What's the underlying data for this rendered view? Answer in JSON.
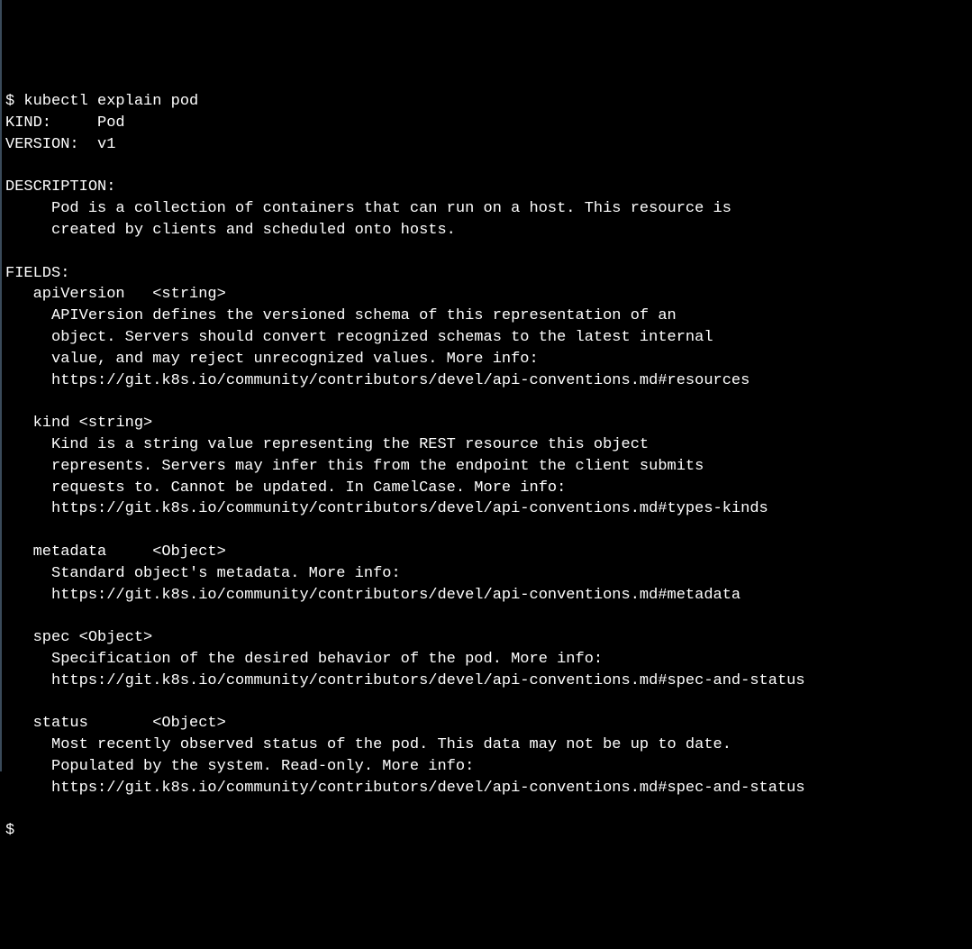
{
  "prompt": "$ ",
  "command": "kubectl explain pod",
  "kind_line": "KIND:     Pod",
  "version_line": "VERSION:  v1",
  "desc_header": "DESCRIPTION:",
  "desc_l1": "     Pod is a collection of containers that can run on a host. This resource is",
  "desc_l2": "     created by clients and scheduled onto hosts.",
  "fields_header": "FIELDS:",
  "f1_name": "   apiVersion   <string>",
  "f1_l1": "     APIVersion defines the versioned schema of this representation of an",
  "f1_l2": "     object. Servers should convert recognized schemas to the latest internal",
  "f1_l3": "     value, and may reject unrecognized values. More info:",
  "f1_l4": "     https://git.k8s.io/community/contributors/devel/api-conventions.md#resources",
  "f2_name": "   kind <string>",
  "f2_l1": "     Kind is a string value representing the REST resource this object",
  "f2_l2": "     represents. Servers may infer this from the endpoint the client submits",
  "f2_l3": "     requests to. Cannot be updated. In CamelCase. More info:",
  "f2_l4": "     https://git.k8s.io/community/contributors/devel/api-conventions.md#types-kinds",
  "f3_name": "   metadata     <Object>",
  "f3_l1": "     Standard object's metadata. More info:",
  "f3_l2": "     https://git.k8s.io/community/contributors/devel/api-conventions.md#metadata",
  "f4_name": "   spec <Object>",
  "f4_l1": "     Specification of the desired behavior of the pod. More info:",
  "f4_l2": "     https://git.k8s.io/community/contributors/devel/api-conventions.md#spec-and-status",
  "f5_name": "   status       <Object>",
  "f5_l1": "     Most recently observed status of the pod. This data may not be up to date.",
  "f5_l2": "     Populated by the system. Read-only. More info:",
  "f5_l3": "     https://git.k8s.io/community/contributors/devel/api-conventions.md#spec-and-status",
  "end_prompt": "$"
}
